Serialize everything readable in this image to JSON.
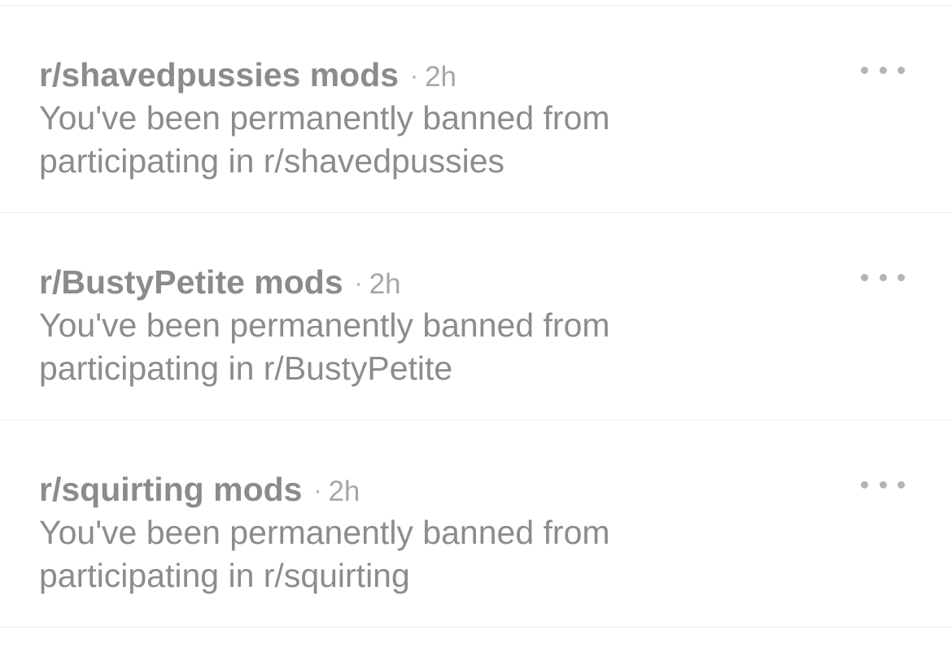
{
  "notifications": [
    {
      "sender": "r/shavedpussies mods",
      "separator": "·",
      "time": "2h",
      "message": "You've been permanently banned from participating in r/shavedpussies",
      "menu_icon": "more-horizontal-icon"
    },
    {
      "sender": "r/BustyPetite mods",
      "separator": "·",
      "time": "2h",
      "message": "You've been permanently banned from participating in r/BustyPetite",
      "menu_icon": "more-horizontal-icon"
    },
    {
      "sender": "r/squirting mods",
      "separator": "·",
      "time": "2h",
      "message": "You've been permanently banned from participating in r/squirting",
      "menu_icon": "more-horizontal-icon"
    }
  ],
  "colors": {
    "background": "#ffffff",
    "text": "#8b8b8b",
    "meta": "#a6a6a6",
    "divider": "#ececec"
  }
}
